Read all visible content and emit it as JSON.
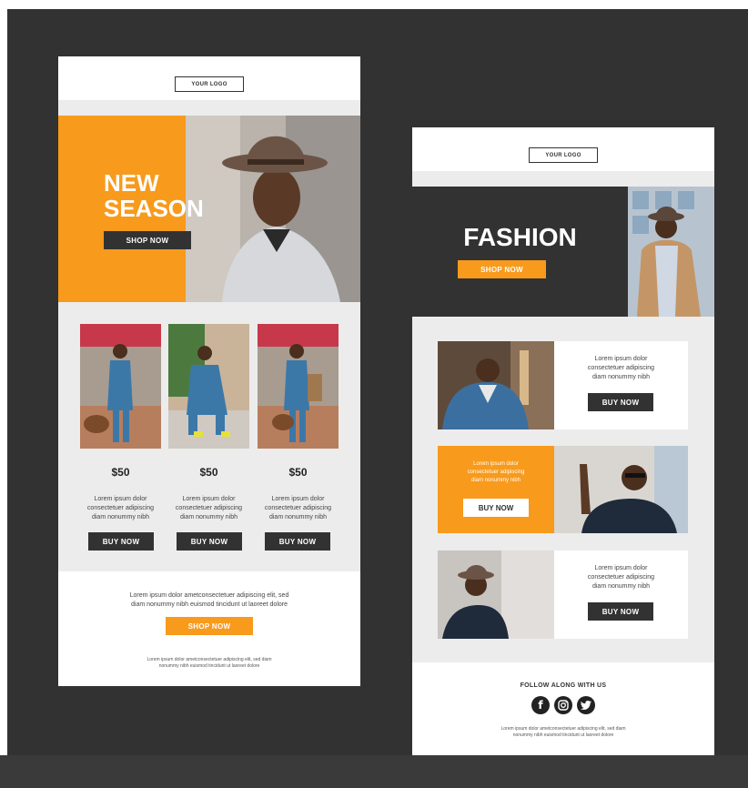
{
  "email1": {
    "logo": "YOUR LOGO",
    "hero": {
      "line1": "NEW",
      "line2": "SEASON",
      "button": "SHOP NOW"
    },
    "products": [
      {
        "price": "$50",
        "desc1": "Lorem ipsum dolor",
        "desc2": "consectetuer adipiscing",
        "desc3": "diam nonummy nibh",
        "button": "BUY NOW"
      },
      {
        "price": "$50",
        "desc1": "Lorem ipsum dolor",
        "desc2": "consectetuer adipiscing",
        "desc3": "diam nonummy nibh",
        "button": "BUY NOW"
      },
      {
        "price": "$50",
        "desc1": "Lorem ipsum dolor",
        "desc2": "consectetuer adipiscing",
        "desc3": "diam nonummy nibh",
        "button": "BUY NOW"
      }
    ],
    "footer": {
      "text1": "Lorem ipsum dolor ametconsectetuer adipiscing elit, sed",
      "text2": "diam nonummy nibh euismod tincidunt ut laoreet dolore",
      "button": "SHOP NOW",
      "small1": "Lorem ipsum dolor ametconsectetuer adipiscing elit, sed diam",
      "small2": "nonummy nibh euismod tincidunt ut laoreet dolore"
    }
  },
  "email2": {
    "logo": "YOUR LOGO",
    "hero": {
      "title": "FASHION",
      "button": "SHOP NOW"
    },
    "rows": [
      {
        "desc1": "Lorem ipsum dolor",
        "desc2": "consectetuer adipiscing",
        "desc3": "diam nonummy nibh",
        "button": "BUY NOW"
      },
      {
        "desc1": "Lorem ipsum dolor",
        "desc2": "consectetuer adipiscing",
        "desc3": "diam nonummy nibh",
        "button": "BUY NOW"
      },
      {
        "desc1": "Lorem ipsum dolor",
        "desc2": "consectetuer adipiscing",
        "desc3": "diam nonummy nibh",
        "button": "BUY NOW"
      }
    ],
    "footer": {
      "follow": "FOLLOW ALONG WITH US",
      "social": [
        "facebook-icon",
        "instagram-icon",
        "twitter-icon"
      ],
      "small1": "Lorem ipsum dolor ametconsectetuer adipiscing elit, sed diam",
      "small2": "nonummy nibh euismod tincidunt ut laoreet dolore"
    }
  },
  "colors": {
    "accent": "#f89a1c",
    "dark": "#323232",
    "panel": "#ececec"
  }
}
